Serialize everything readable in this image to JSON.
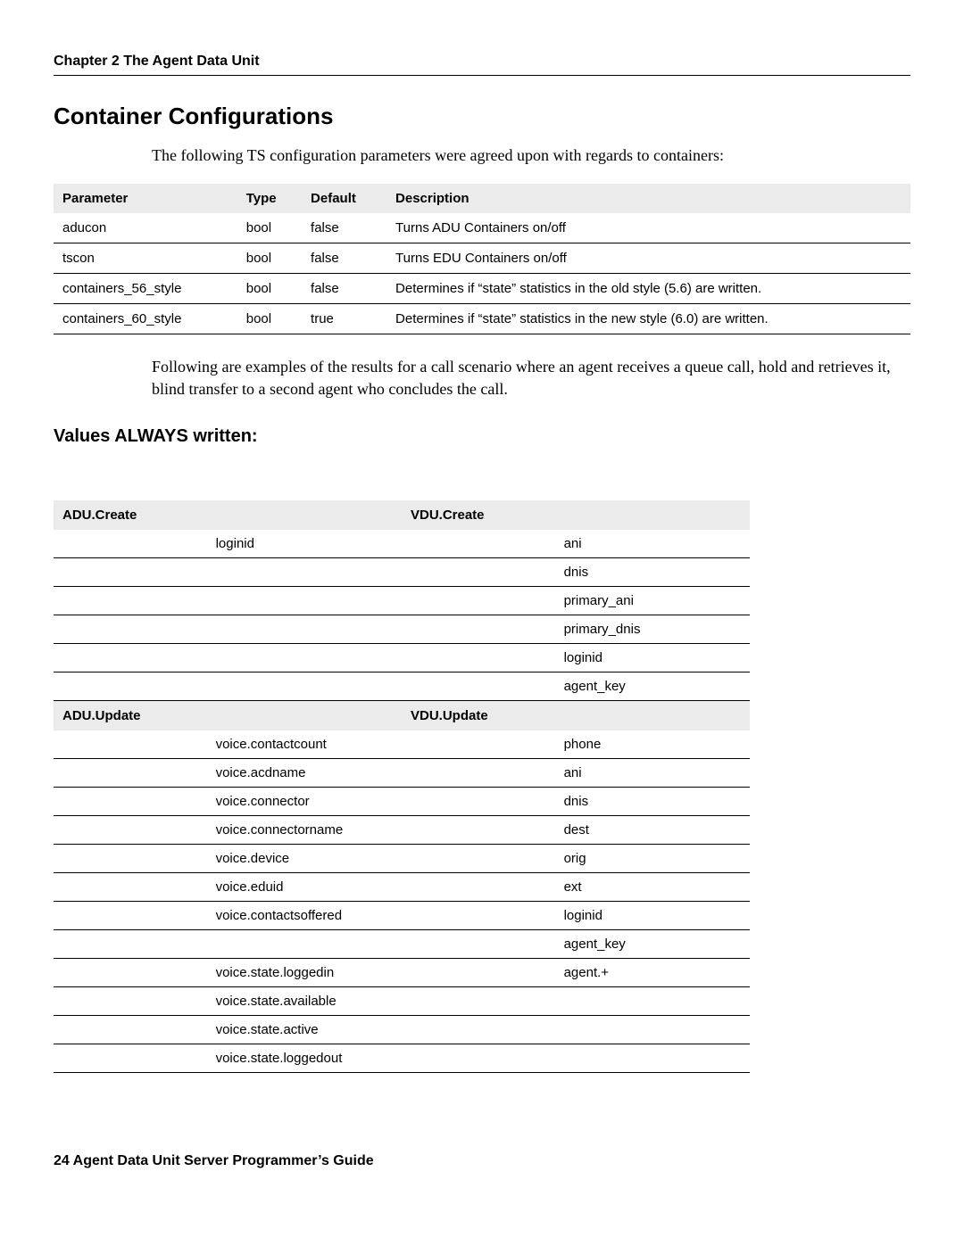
{
  "chapter_line": "Chapter 2   The Agent Data Unit",
  "section_title": "Container Configurations",
  "intro_text": "The following TS configuration parameters were agreed upon with regards to containers:",
  "params": {
    "headers": [
      "Parameter",
      "Type",
      "Default",
      "Description"
    ],
    "rows": [
      {
        "param": "aducon",
        "type": "bool",
        "default": "false",
        "desc": "Turns ADU Containers on/off"
      },
      {
        "param": "tscon",
        "type": "bool",
        "default": "false",
        "desc": "Turns EDU Containers on/off"
      },
      {
        "param": "containers_56_style",
        "type": "bool",
        "default": "false",
        "desc": "Determines if “state” statistics in the old style (5.6) are written."
      },
      {
        "param": "containers_60_style",
        "type": "bool",
        "default": "true",
        "desc": "Determines if “state” statistics in the new style (6.0) are written."
      }
    ]
  },
  "followup_text": "Following are examples of the results for a call scenario where an agent receives a queue call, hold and retrieves it, blind transfer to a second agent who concludes the call.",
  "sub_title": "Values ALWAYS written:",
  "values_table": {
    "headers1": [
      "ADU.Create",
      "VDU.Create"
    ],
    "rows1": [
      {
        "a": "",
        "b": "loginid",
        "c": "",
        "d": "ani"
      },
      {
        "a": "",
        "b": "",
        "c": "",
        "d": "dnis"
      },
      {
        "a": "",
        "b": "",
        "c": "",
        "d": "primary_ani"
      },
      {
        "a": "",
        "b": "",
        "c": "",
        "d": "primary_dnis"
      },
      {
        "a": "",
        "b": "",
        "c": "",
        "d": "loginid"
      },
      {
        "a": "",
        "b": "",
        "c": "",
        "d": "agent_key"
      }
    ],
    "headers2": [
      "ADU.Update",
      "VDU.Update"
    ],
    "rows2": [
      {
        "a": "",
        "b": "voice.contactcount",
        "c": "",
        "d": "phone"
      },
      {
        "a": "",
        "b": "voice.acdname",
        "c": "",
        "d": "ani"
      },
      {
        "a": "",
        "b": "voice.connector",
        "c": "",
        "d": "dnis"
      },
      {
        "a": "",
        "b": "voice.connectorname",
        "c": "",
        "d": "dest"
      },
      {
        "a": "",
        "b": "voice.device",
        "c": "",
        "d": "orig"
      },
      {
        "a": "",
        "b": "voice.eduid",
        "c": "",
        "d": "ext"
      },
      {
        "a": "",
        "b": "voice.contactsoffered",
        "c": "",
        "d": "loginid"
      },
      {
        "a": "",
        "b": "",
        "c": "",
        "d": "agent_key"
      },
      {
        "a": "",
        "b": "voice.state.loggedin",
        "c": "",
        "d": "agent.+"
      },
      {
        "a": "",
        "b": "voice.state.available",
        "c": "",
        "d": ""
      },
      {
        "a": "",
        "b": "voice.state.active",
        "c": "",
        "d": ""
      },
      {
        "a": "",
        "b": "voice.state.loggedout",
        "c": "",
        "d": ""
      }
    ]
  },
  "footer": "24   Agent Data Unit Server Programmer’s Guide"
}
